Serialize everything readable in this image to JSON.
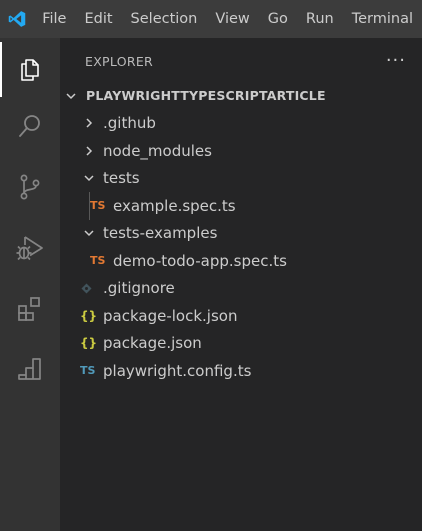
{
  "menu": {
    "items": [
      "File",
      "Edit",
      "Selection",
      "View",
      "Go",
      "Run",
      "Terminal"
    ]
  },
  "activity_bar": {
    "items": [
      "explorer-icon",
      "search-icon",
      "source-control-icon",
      "run-debug-icon",
      "extensions-icon",
      "testing-icon"
    ],
    "active": "explorer-icon"
  },
  "sidebar": {
    "title": "EXPLORER",
    "more_actions": "···",
    "root": "PLAYWRIGHTTYPESCRIPTARTICLE",
    "tree": [
      {
        "label": ".github",
        "type": "folder",
        "expanded": false
      },
      {
        "label": "node_modules",
        "type": "folder",
        "expanded": false
      },
      {
        "label": "tests",
        "type": "folder",
        "expanded": true
      },
      {
        "label": "example.spec.ts",
        "type": "ts-file",
        "icon_text": "TS"
      },
      {
        "label": "tests-examples",
        "type": "folder",
        "expanded": true
      },
      {
        "label": "demo-todo-app.spec.ts",
        "type": "ts-file",
        "icon_text": "TS"
      },
      {
        "label": ".gitignore",
        "type": "gitignore-file"
      },
      {
        "label": "package-lock.json",
        "type": "json-file",
        "icon_text": "{}"
      },
      {
        "label": "package.json",
        "type": "json-file",
        "icon_text": "{}"
      },
      {
        "label": "playwright.config.ts",
        "type": "ts-config-file",
        "icon_text": "TS"
      }
    ]
  },
  "colors": {
    "titlebar": "#3c3c3c",
    "activity_bar": "#333333",
    "sidebar": "#252526",
    "vscode_blue": "#23a9f2",
    "ts_orange": "#e37933",
    "ts_blue": "#519aba",
    "json_yellow": "#cbcb41"
  }
}
